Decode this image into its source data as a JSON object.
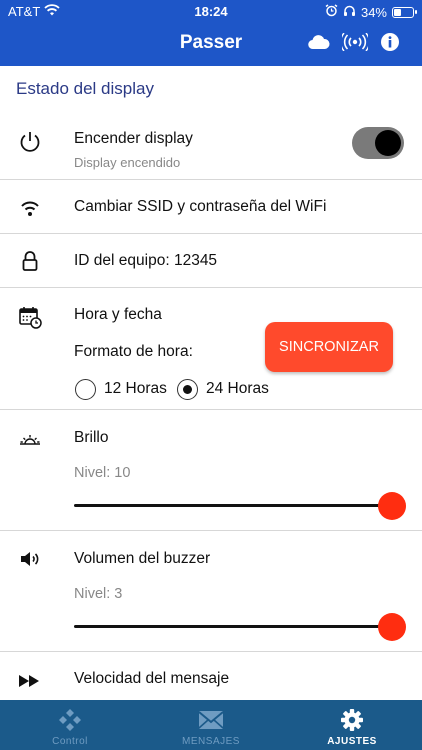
{
  "status_bar": {
    "carrier": "AT&T",
    "time": "18:24",
    "battery": "34%",
    "battery_level": 0.34
  },
  "header": {
    "title": "Passer",
    "icons": [
      "cloud-icon",
      "broadcast-icon",
      "info-icon"
    ]
  },
  "section_title": "Estado del display",
  "display_row": {
    "label": "Encender display",
    "sublabel": "Display encendido",
    "toggle_on": true
  },
  "wifi_row": {
    "label": "Cambiar SSID y contraseña del WiFi"
  },
  "id_row": {
    "label": "ID del equipo: 12345"
  },
  "time_row": {
    "label": "Hora y fecha",
    "format_label": "Formato de hora:",
    "sync_button": "SINCRONIZAR",
    "options": [
      {
        "label": "12 Horas",
        "selected": false
      },
      {
        "label": "24 Horas",
        "selected": true
      }
    ]
  },
  "brightness_row": {
    "label": "Brillo",
    "level_text": "Nivel: 10",
    "level_fraction": 1.0
  },
  "buzzer_row": {
    "label": "Volumen del buzzer",
    "level_text": "Nivel: 3",
    "level_fraction": 1.0
  },
  "speed_row": {
    "label": "Velocidad del mensaje"
  },
  "tabs": [
    {
      "label": "Control",
      "icon": "gamepad-icon",
      "active": false
    },
    {
      "label": "MENSAJES",
      "icon": "envelope-icon",
      "active": false
    },
    {
      "label": "AJUSTES",
      "icon": "gear-icon",
      "active": true
    }
  ],
  "colors": {
    "header_bg": "#1e56c8",
    "accent": "#ff4a2c",
    "slider_thumb": "#ff2d10",
    "tabbar_bg": "#1b5a8a",
    "section_title": "#2b3a86"
  }
}
